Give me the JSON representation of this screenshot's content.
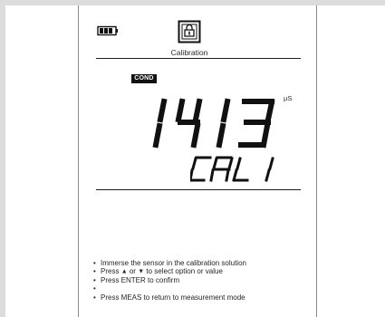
{
  "screen": {
    "title": "Calibration",
    "badge": "COND",
    "value_display": "1413",
    "unit": "µS",
    "mode_display": "CAL1"
  },
  "instructions": {
    "line1": "Immerse the sensor in the calibration solution",
    "line2_prefix": "Press",
    "line2_up_icon": "▲",
    "line2_mid": "or",
    "line2_down_icon": "▼",
    "line2_suffix": "to select option or value",
    "line3": "Press ENTER to confirm",
    "line4": "Press MEAS to return to measurement mode"
  },
  "icons": {
    "battery": "battery-icon",
    "calibration": "calibration-icon",
    "up_arrow": "up-arrow-icon",
    "down_arrow": "down-arrow-icon"
  },
  "colors": {
    "background": "#ffffff",
    "outer_frame": "#dcdcdc",
    "text": "#262626",
    "lines": "#1f1f1f",
    "badge_bg": "#111111",
    "badge_text": "#ffffff"
  }
}
